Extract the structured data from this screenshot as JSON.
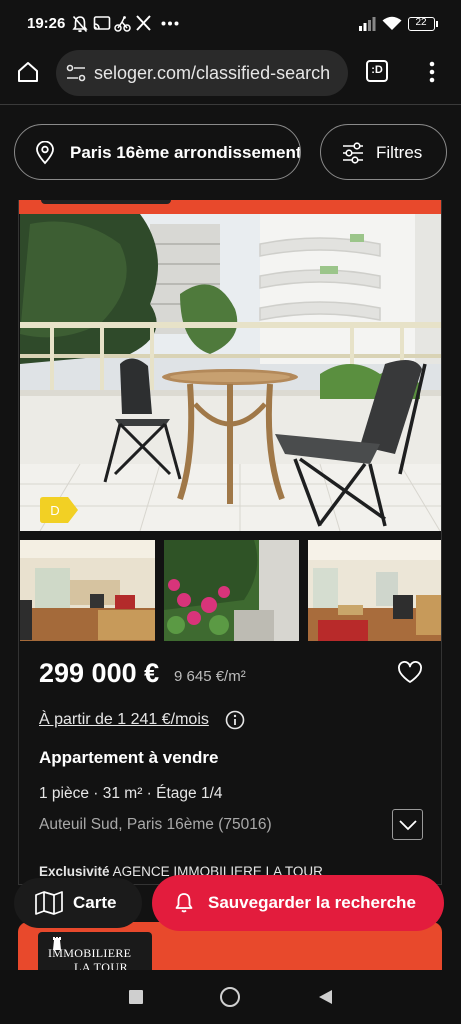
{
  "status_bar": {
    "time": "19:26",
    "battery": "22",
    "icons": [
      "silent-bell-icon",
      "cast-icon",
      "bike-icon",
      "x-logo-icon",
      "more-dots-icon",
      "signal-icon",
      "wifi-icon",
      "battery-icon"
    ]
  },
  "browser": {
    "url": "seloger.com/classified-search",
    "tab_label": ":D",
    "icons": [
      "home-icon",
      "site-settings-icon",
      "tab-switcher-icon",
      "menu-dots-icon"
    ]
  },
  "search": {
    "location": "Paris 16ème arrondissement",
    "filters_label": "Filtres"
  },
  "listing": {
    "energy_class": "D",
    "price": "299 000 €",
    "price_per_sqm": "9 645 €/m²",
    "monthly": "À partir de 1 241 €/mois",
    "property_type": "Appartement à vendre",
    "specs": "1 pièce  ·  31 m²  ·  Étage 1/4",
    "address": "Auteuil Sud, Paris 16ème (75016)",
    "agency_label": "Exclusivité",
    "agency_name": "AGENCE IMMOBILIERE LA TOUR"
  },
  "actions": {
    "map_label": "Carte",
    "save_label": "Sauvegarder la recherche"
  },
  "next_listing": {
    "logo_line1": "IMMOBILIERE",
    "logo_line2": "LA TOUR"
  },
  "colors": {
    "accent": "#e8492c",
    "save_button": "#e31c3d",
    "energy_badge": "#f2d024",
    "background": "#121212"
  }
}
